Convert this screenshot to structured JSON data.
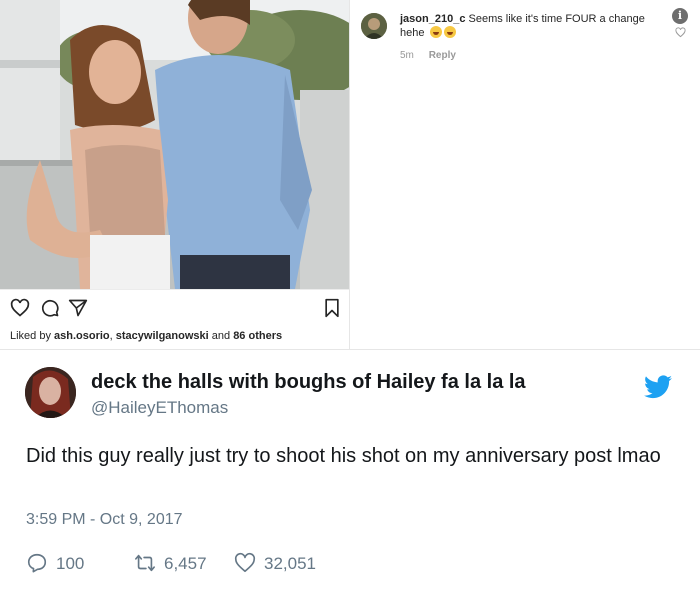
{
  "instagram": {
    "likes": {
      "prefix": "Liked by ",
      "user1": "ash.osorio",
      "sep": ", ",
      "user2": "stacywilganowski",
      "and": " and ",
      "others": "86 others"
    },
    "comment": {
      "username": "jason_210_c",
      "text": " Seems like it's time FOUR a change hehe",
      "time": "5m",
      "reply_label": "Reply"
    },
    "info_icon": "i"
  },
  "tweet": {
    "display_name": "deck the halls with boughs of Hailey fa la la la",
    "handle": "@HaileyEThomas",
    "text": "Did this guy really just try to shoot his shot on my anniversary post lmao",
    "timestamp": "3:59 PM - Oct 9, 2017",
    "stats": {
      "replies": "100",
      "retweets": "6,457",
      "likes": "32,051"
    }
  },
  "colors": {
    "twitter_blue": "#1da1f2",
    "twitter_gray": "#657786",
    "ig_text": "#262626"
  },
  "icons": [
    "heart-icon",
    "comment-icon",
    "share-icon",
    "bookmark-icon",
    "info-icon",
    "twitter-bird-icon",
    "reply-icon",
    "retweet-icon",
    "like-icon"
  ]
}
